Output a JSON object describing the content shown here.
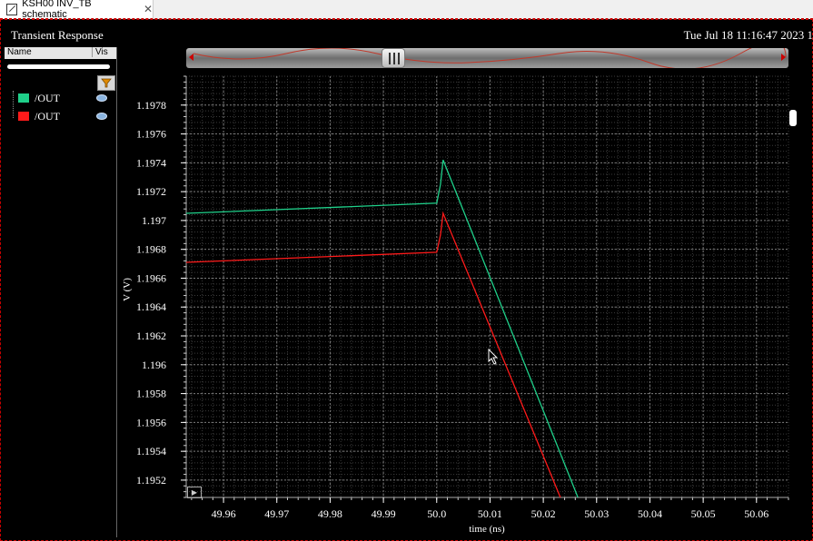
{
  "tab": {
    "title": "KSH00 INV_TB schematic",
    "close": "✕"
  },
  "header": {
    "title": "Transient Response",
    "date": "Tue Jul 18 11:16:47 2023   1"
  },
  "legend": {
    "col_name": "Name",
    "col_vis": "Vis",
    "items": [
      {
        "label": "/OUT",
        "color": "#1fd08a",
        "visible_icon": "eye-icon"
      },
      {
        "label": "/OUT",
        "color": "#ff1a1a",
        "visible_icon": "eye-icon"
      }
    ]
  },
  "chart_data": {
    "type": "line",
    "xlabel": "time (ns)",
    "ylabel": "V (V)",
    "xlim": [
      49.953,
      50.066
    ],
    "ylim": [
      1.19508,
      1.198
    ],
    "x_ticks": [
      "49.96",
      "49.97",
      "49.98",
      "49.99",
      "50.0",
      "50.01",
      "50.02",
      "50.03",
      "50.04",
      "50.05",
      "50.06"
    ],
    "y_ticks": [
      "1.1952",
      "1.1954",
      "1.1956",
      "1.1958",
      "1.196",
      "1.1962",
      "1.1964",
      "1.1966",
      "1.1968",
      "1.197",
      "1.1972",
      "1.1974",
      "1.1976",
      "1.1978"
    ],
    "grid": true,
    "series": [
      {
        "name": "/OUT",
        "color": "#1fd08a",
        "x": [
          49.953,
          50.0,
          50.0007,
          50.0012,
          50.0265
        ],
        "y": [
          1.19705,
          1.19712,
          1.19725,
          1.19742,
          1.19508
        ]
      },
      {
        "name": "/OUT",
        "color": "#ff1a1a",
        "x": [
          49.953,
          50.0,
          50.0007,
          50.0012,
          50.0232
        ],
        "y": [
          1.19671,
          1.19678,
          1.1969,
          1.19705,
          1.19508
        ]
      }
    ]
  }
}
